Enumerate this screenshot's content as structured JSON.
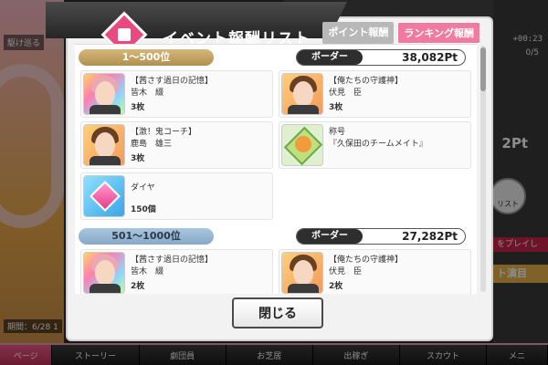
{
  "background": {
    "left_label": "駆け巡る",
    "left_bottom": "期間：6/28 1",
    "timer": "+00:23",
    "count": "0/5",
    "pt": "2Pt",
    "right_circle_label": "リスト",
    "banner1": "をプレイし",
    "banner2": "ト演目",
    "nav": [
      "ページ",
      "ストーリー",
      "劇団員",
      "お芝居",
      "出稼ぎ",
      "スカウト",
      "メニ"
    ]
  },
  "modal": {
    "title": "イベント報酬リスト",
    "tabs": {
      "point": "ポイント報酬",
      "ranking": "ランキング報酬"
    },
    "close": "閉じる"
  },
  "sections": [
    {
      "rank": "1～500位",
      "border_label": "ボーダー",
      "border_value": "38,082Pt",
      "rewards": [
        {
          "title": "【茜さす過日の記憶】",
          "name": "皆木　綴",
          "count": "3枚",
          "icon": "card-icon"
        },
        {
          "title": "【俺たちの守護神】",
          "name": "伏見　臣",
          "count": "3枚",
          "icon": "card-icon"
        },
        {
          "title": "【激！鬼コーチ】",
          "name": "鹿島　雄三",
          "count": "3枚",
          "icon": "card-icon"
        },
        {
          "title": "称号",
          "name": "『久保田のチームメイト』",
          "count": "",
          "icon": "medal-icon"
        },
        {
          "title": "ダイヤ",
          "name": "",
          "count": "150個",
          "icon": "diamond-icon"
        }
      ]
    },
    {
      "rank": "501～1000位",
      "border_label": "ボーダー",
      "border_value": "27,282Pt",
      "rewards": [
        {
          "title": "【茜さす過日の記憶】",
          "name": "皆木　綴",
          "count": "2枚",
          "icon": "card-icon"
        },
        {
          "title": "【俺たちの守護神】",
          "name": "伏見　臣",
          "count": "2枚",
          "icon": "card-icon"
        }
      ]
    }
  ]
}
